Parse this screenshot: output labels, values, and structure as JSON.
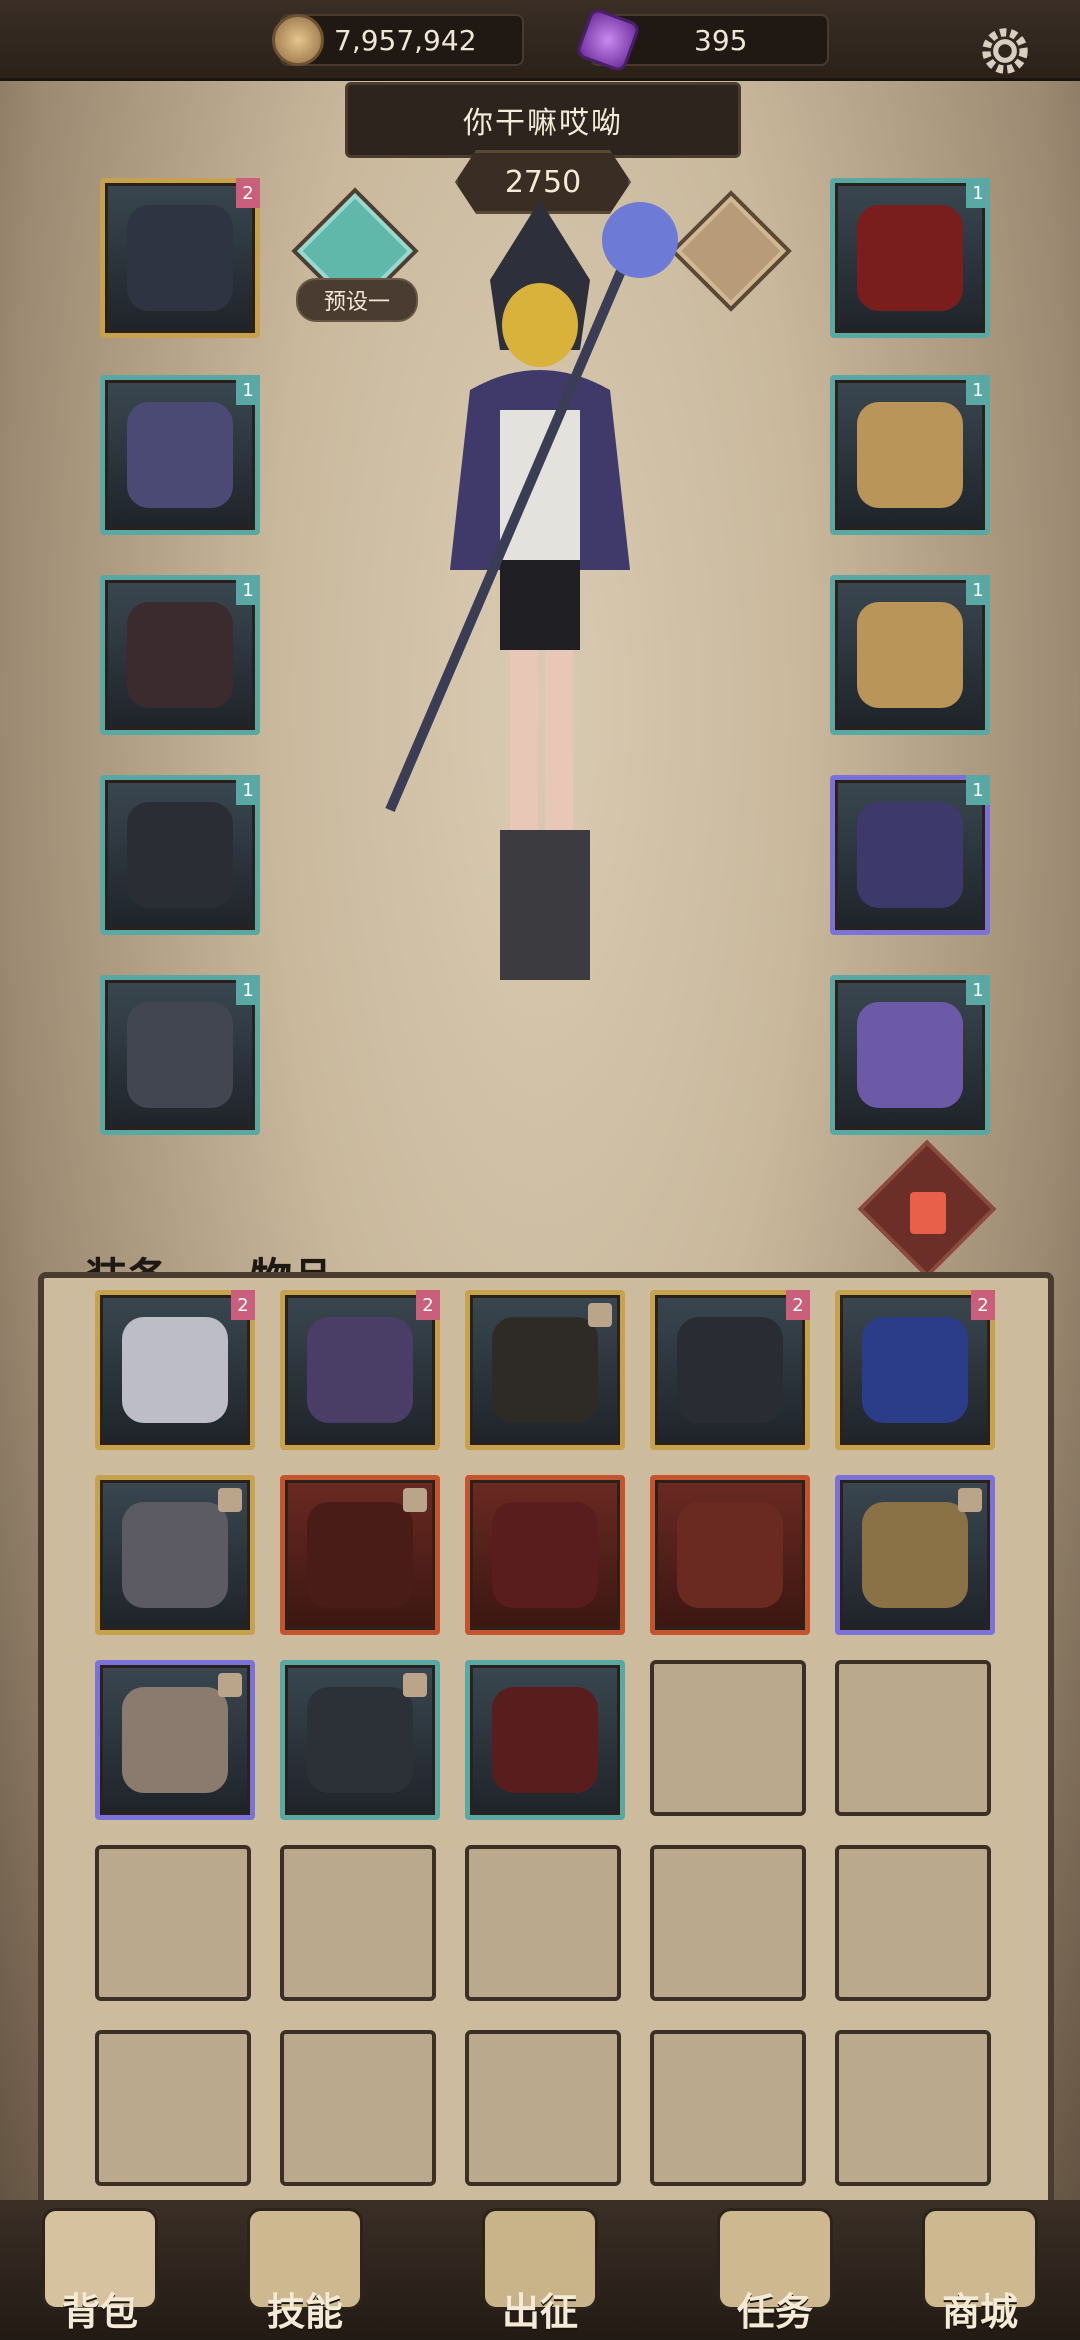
{
  "resources": {
    "gold": "7,957,942",
    "gems": "395"
  },
  "hero": {
    "name": "你干嘛哎呦",
    "power": "2750",
    "preset_label": "预设一"
  },
  "equipment_left_levels": [
    "2",
    "1",
    "1",
    "1",
    "1"
  ],
  "equipment_right_levels": [
    "1",
    "1",
    "1",
    "1",
    "1"
  ],
  "tabs": {
    "equip": "装备",
    "items": "物品"
  },
  "inventory_levels": [
    "2",
    "2",
    "",
    "2",
    "2"
  ],
  "nav": {
    "bag": "背包",
    "skills": "技能",
    "expedition": "出征",
    "tasks": "任务",
    "shop": "商城"
  }
}
